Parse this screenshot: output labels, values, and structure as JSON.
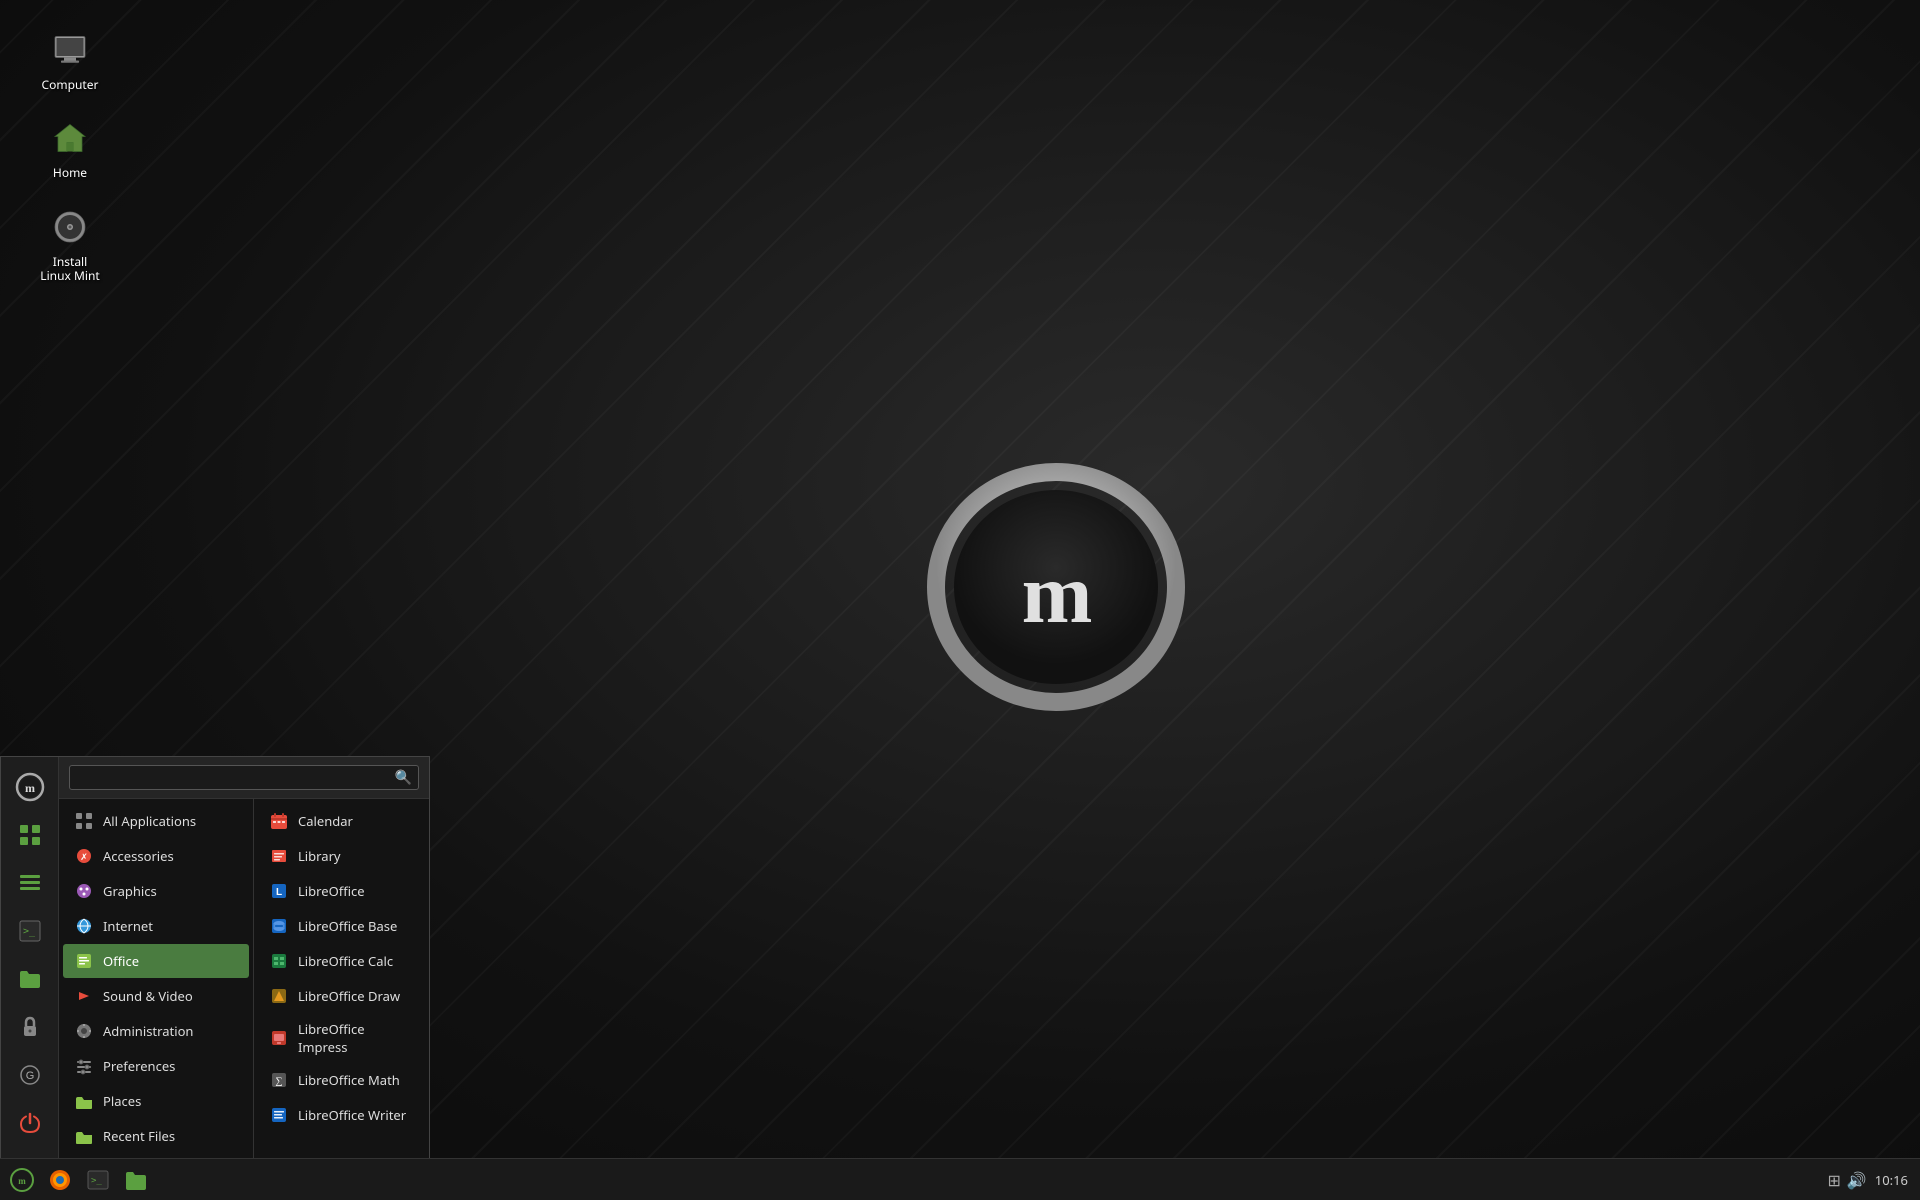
{
  "desktop": {
    "background_desc": "dark textured desktop"
  },
  "desktop_icons": [
    {
      "id": "computer",
      "label": "Computer",
      "icon_type": "computer"
    },
    {
      "id": "home",
      "label": "Home",
      "icon_type": "home"
    },
    {
      "id": "install",
      "label": "Install Linux Mint",
      "icon_type": "disc"
    }
  ],
  "taskbar": {
    "time": "10:16",
    "buttons": [
      {
        "id": "mint-menu",
        "icon": "mint"
      },
      {
        "id": "firefox",
        "icon": "firefox"
      },
      {
        "id": "terminal",
        "icon": "terminal"
      },
      {
        "id": "files",
        "icon": "files"
      }
    ]
  },
  "start_menu": {
    "search_placeholder": "",
    "sidebar_icons": [
      {
        "id": "mint-logo",
        "icon": "mint"
      },
      {
        "id": "grid",
        "icon": "grid"
      },
      {
        "id": "list",
        "icon": "list"
      },
      {
        "id": "terminal-icon",
        "icon": "terminal"
      },
      {
        "id": "folder-icon",
        "icon": "folder"
      },
      {
        "id": "lock-icon",
        "icon": "lock"
      },
      {
        "id": "g-icon",
        "icon": "g"
      },
      {
        "id": "power-icon",
        "icon": "power"
      }
    ],
    "left_column": [
      {
        "id": "all-applications",
        "label": "All Applications",
        "icon_color": "#888",
        "icon_type": "grid",
        "active": false
      },
      {
        "id": "accessories",
        "label": "Accessories",
        "icon_color": "#e74c3c",
        "icon_type": "wrench",
        "active": false
      },
      {
        "id": "graphics",
        "label": "Graphics",
        "icon_color": "#9b59b6",
        "icon_type": "graphics",
        "active": false
      },
      {
        "id": "internet",
        "label": "Internet",
        "icon_color": "#3498db",
        "icon_type": "internet",
        "active": false
      },
      {
        "id": "office",
        "label": "Office",
        "icon_color": "#8bc34a",
        "icon_type": "office",
        "active": true
      },
      {
        "id": "sound-video",
        "label": "Sound & Video",
        "icon_color": "#e74c3c",
        "icon_type": "sound",
        "active": false
      },
      {
        "id": "administration",
        "label": "Administration",
        "icon_color": "#888",
        "icon_type": "admin",
        "active": false
      },
      {
        "id": "preferences",
        "label": "Preferences",
        "icon_color": "#888",
        "icon_type": "prefs",
        "active": false
      },
      {
        "id": "places",
        "label": "Places",
        "icon_color": "#8bc34a",
        "icon_type": "folder",
        "active": false
      },
      {
        "id": "recent-files",
        "label": "Recent Files",
        "icon_color": "#8bc34a",
        "icon_type": "folder",
        "active": false
      }
    ],
    "right_column": [
      {
        "id": "calendar",
        "label": "Calendar",
        "icon_color": "#e74c3c",
        "icon_type": "calendar"
      },
      {
        "id": "library",
        "label": "Library",
        "icon_color": "#e74c3c",
        "icon_type": "library"
      },
      {
        "id": "libreoffice",
        "label": "LibreOffice",
        "icon_color": "#1565c0",
        "icon_type": "libreoffice"
      },
      {
        "id": "libreoffice-base",
        "label": "LibreOffice Base",
        "icon_color": "#1565c0",
        "icon_type": "lo-base"
      },
      {
        "id": "libreoffice-calc",
        "label": "LibreOffice Calc",
        "icon_color": "#1b7a3e",
        "icon_type": "lo-calc"
      },
      {
        "id": "libreoffice-draw",
        "label": "LibreOffice Draw",
        "icon_color": "#c0392b",
        "icon_type": "lo-draw"
      },
      {
        "id": "libreoffice-impress",
        "label": "LibreOffice Impress",
        "icon_color": "#c0392b",
        "icon_type": "lo-impress"
      },
      {
        "id": "libreoffice-math",
        "label": "LibreOffice Math",
        "icon_color": "#555",
        "icon_type": "lo-math"
      },
      {
        "id": "libreoffice-writer",
        "label": "LibreOffice Writer",
        "icon_color": "#1565c0",
        "icon_type": "lo-writer"
      }
    ]
  }
}
